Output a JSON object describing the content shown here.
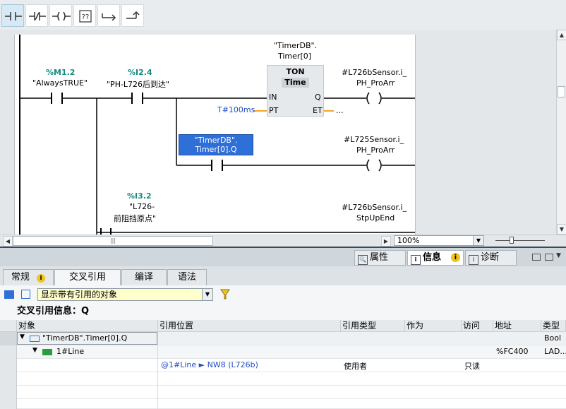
{
  "toolbar": {
    "buttons": [
      {
        "name": "contact-no"
      },
      {
        "name": "contact-nc"
      },
      {
        "name": "coil"
      },
      {
        "name": "empty-box"
      },
      {
        "name": "open-branch"
      },
      {
        "name": "close-branch"
      }
    ]
  },
  "ladder": {
    "contact1": {
      "address": "%M1.2",
      "symbol": "\"AlwaysTRUE\""
    },
    "contact2": {
      "address": "%I2.4",
      "symbol": "\"PH-L726后到达\""
    },
    "timer": {
      "db_line1": "\"TimerDB\".",
      "db_line2": "Timer[0]",
      "type": "TON",
      "subtype": "Time",
      "in": "IN",
      "q": "Q",
      "pt": "PT",
      "et": "ET",
      "pt_value": "T#100ms",
      "et_value": "..."
    },
    "coil1": {
      "line1": "#L726bSensor.i_",
      "line2": "PH_ProArr"
    },
    "selected_contact": {
      "line1": "\"TimerDB\".",
      "line2": "Timer[0].Q"
    },
    "coil2": {
      "line1": "#L725Sensor.i_",
      "line2": "PH_ProArr"
    },
    "contact3": {
      "address": "%I3.2",
      "line1": "\"L726-",
      "line2": "前阻挡原点\""
    },
    "coil3": {
      "line1": "#L726bSensor.i_",
      "line2": "StpUpEnd"
    }
  },
  "zoom": {
    "value": "100%"
  },
  "inspector": {
    "tabs": [
      {
        "label": "属性"
      },
      {
        "label": "信息"
      },
      {
        "label": "诊断"
      }
    ],
    "subtabs": [
      {
        "label": "常规"
      },
      {
        "label": "交叉引用"
      },
      {
        "label": "编译"
      },
      {
        "label": "语法"
      }
    ],
    "filter": {
      "value": "显示带有引用的对象"
    },
    "xref_title": "交叉引用信息：Q",
    "columns": [
      "对象",
      "引用位置",
      "引用类型",
      "作为",
      "访问",
      "地址",
      "类型"
    ],
    "rows": [
      {
        "object": "\"TimerDB\".Timer[0].Q",
        "location": "",
        "ref_type": "",
        "as": "",
        "access": "",
        "address": "",
        "type": "Bool"
      },
      {
        "object": "1#Line",
        "location": "",
        "ref_type": "",
        "as": "",
        "access": "",
        "address": "%FC400",
        "type": "LAD..."
      },
      {
        "object": "",
        "location": "@1#Line ► NW8 (L726b)",
        "ref_type": "使用者",
        "as": "",
        "access": "只读",
        "address": "",
        "type": ""
      }
    ]
  },
  "colors": {
    "accent": "#2f6fd8",
    "green_tag": "#168c82",
    "selection": "#2f6fd8",
    "link_blue": "#1f4fc2",
    "orange_wire": "#f5a623"
  }
}
